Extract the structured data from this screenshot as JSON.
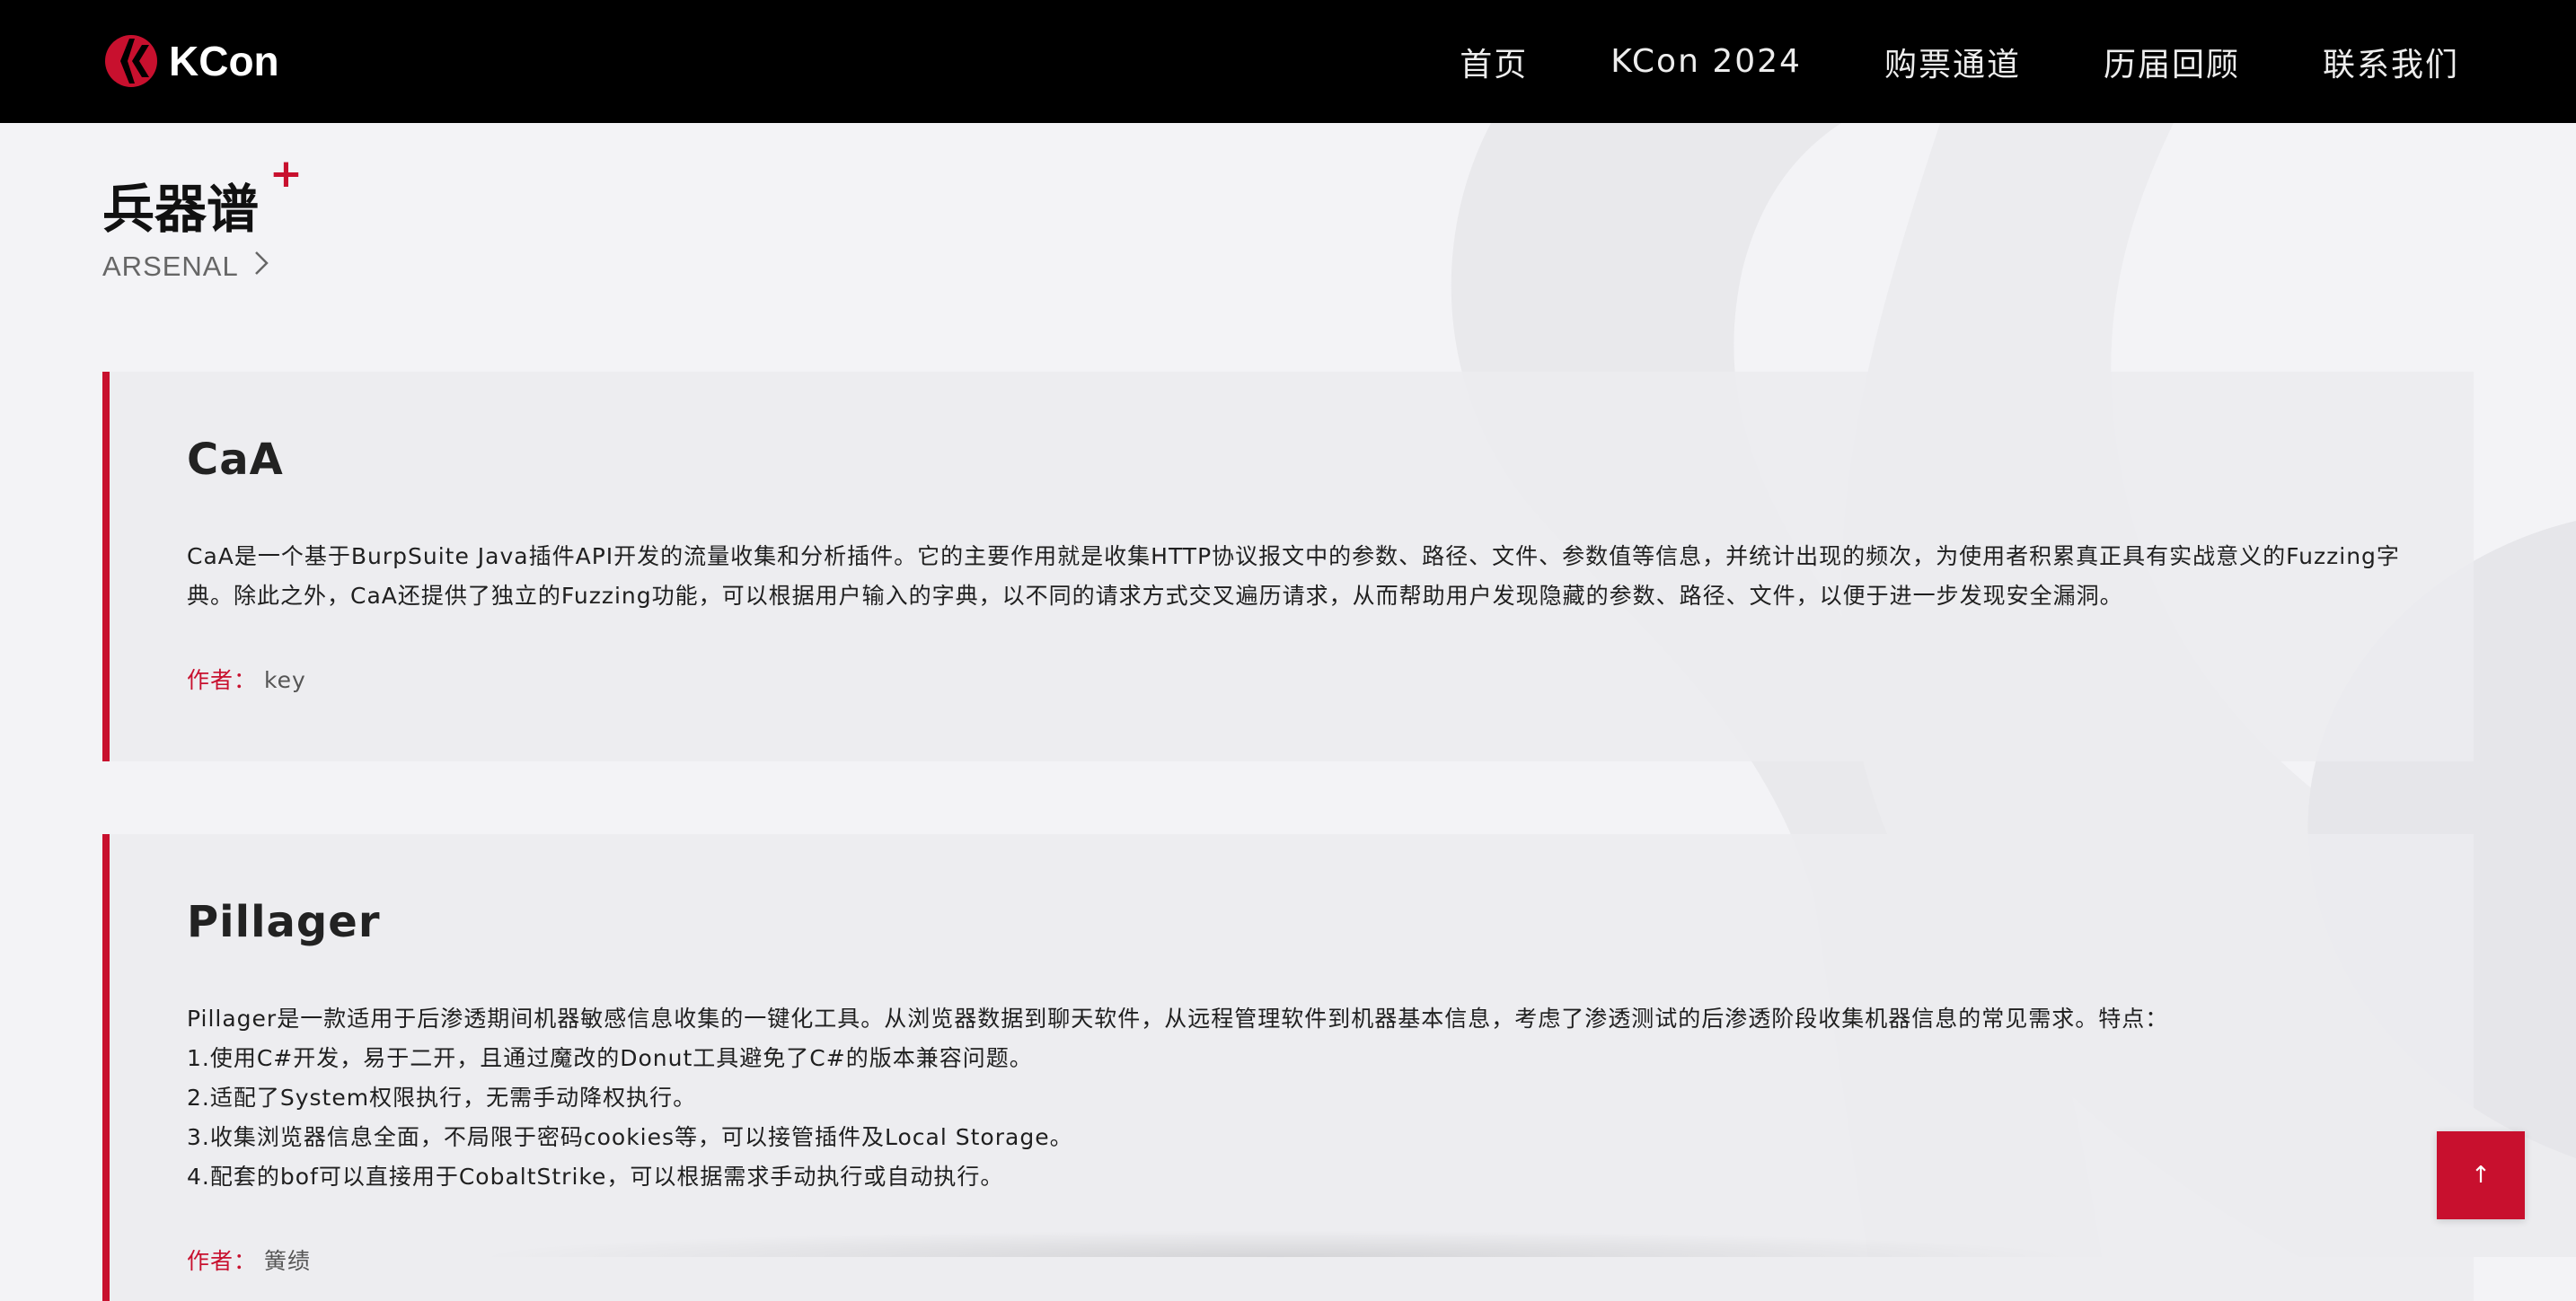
{
  "brand": {
    "name": "KCon",
    "accent_color": "#c8102e",
    "logo_icon": "kcon-logo-icon"
  },
  "nav": {
    "items": [
      {
        "label": "首页"
      },
      {
        "label": "KCon 2024"
      },
      {
        "label": "购票通道"
      },
      {
        "label": "历届回顾"
      },
      {
        "label": "联系我们"
      }
    ]
  },
  "section": {
    "title": "兵器谱",
    "plus": "+",
    "subtitle": "ARSENAL",
    "subtitle_icon": "chevron-right-icon"
  },
  "cards": [
    {
      "title": "CaA",
      "lines": [
        "CaA是一个基于BurpSuite Java插件API开发的流量收集和分析插件。它的主要作用就是收集HTTP协议报文中的参数、路径、文件、参数值等信息，并统计出现的频次，为使用者积累真正具有实战意义的Fuzzing字",
        "典。除此之外，CaA还提供了独立的Fuzzing功能，可以根据用户输入的字典，以不同的请求方式交叉遍历请求，从而帮助用户发现隐藏的参数、路径、文件，以便于进一步发现安全漏洞。"
      ],
      "author_label": "作者：",
      "author": "key"
    },
    {
      "title": "Pillager",
      "lines": [
        "Pillager是一款适用于后渗透期间机器敏感信息收集的一键化工具。从浏览器数据到聊天软件，从远程管理软件到机器基本信息，考虑了渗透测试的后渗透阶段收集机器信息的常见需求。特点：",
        "1.使用C#开发，易于二开，且通过魔改的Donut工具避免了C#的版本兼容问题。",
        "2.适配了System权限执行，无需手动降权执行。",
        "3.收集浏览器信息全面，不局限于密码cookies等，可以接管插件及Local Storage。",
        "4.配套的bof可以直接用于CobaltStrike，可以根据需求手动执行或自动执行。"
      ],
      "author_label": "作者：",
      "author": "簧绩"
    }
  ],
  "back_to_top": {
    "label": "↑",
    "icon": "arrow-up-icon"
  }
}
